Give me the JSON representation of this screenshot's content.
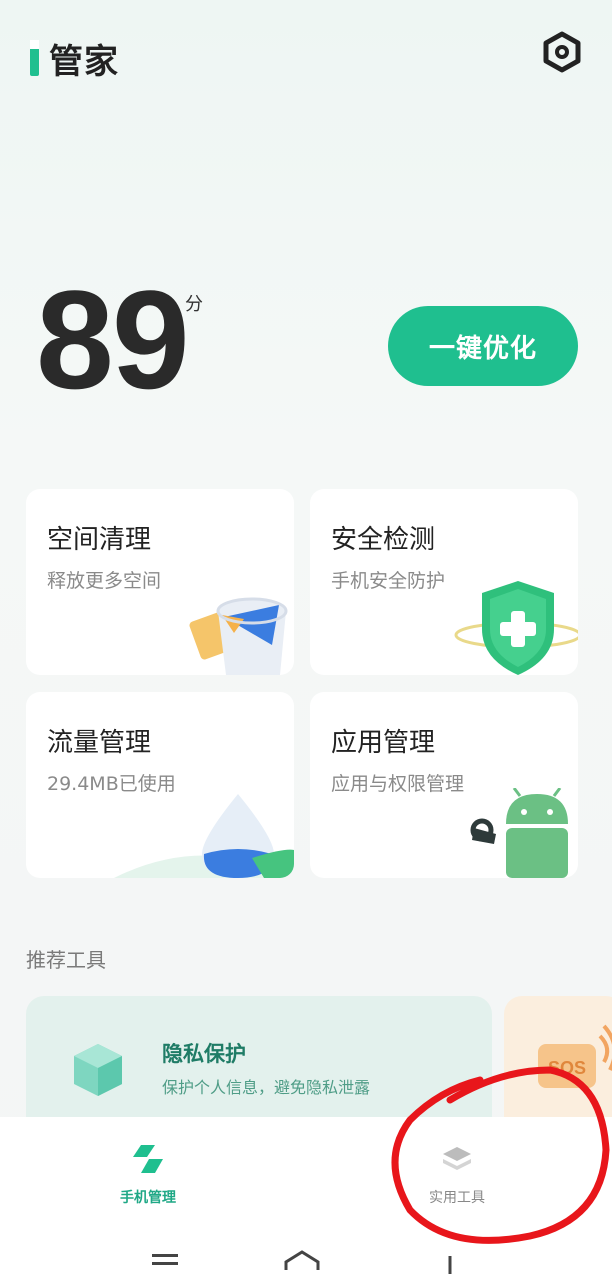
{
  "app": {
    "title": "管家"
  },
  "score": {
    "value": "89",
    "unit": "分"
  },
  "actions": {
    "optimize_label": "一键优化"
  },
  "cards": [
    {
      "title": "空间清理",
      "subtitle": "释放更多空间",
      "icon": "storage-clean-icon"
    },
    {
      "title": "安全检测",
      "subtitle": "手机安全防护",
      "icon": "shield-icon"
    },
    {
      "title": "流量管理",
      "subtitle": "29.4MB已使用",
      "icon": "data-drop-icon"
    },
    {
      "title": "应用管理",
      "subtitle": "应用与权限管理",
      "icon": "android-robot-icon"
    }
  ],
  "recommended": {
    "section_title": "推荐工具",
    "items": [
      {
        "title": "隐私保护",
        "subtitle": "保护个人信息，避免隐私泄露",
        "icon": "privacy-cube-icon"
      },
      {
        "title": "",
        "subtitle": "",
        "badge": "SOS",
        "icon": "sos-icon"
      }
    ]
  },
  "bottom_nav": [
    {
      "label": "手机管理",
      "active": true,
      "icon": "phone-manage-icon"
    },
    {
      "label": "实用工具",
      "active": false,
      "icon": "layers-icon"
    }
  ],
  "colors": {
    "accent": "#1fbf8f",
    "annotation": "#e8161b"
  }
}
